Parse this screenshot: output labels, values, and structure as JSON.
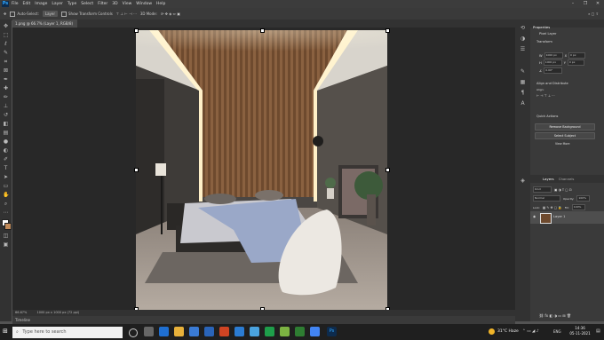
{
  "menu": {
    "logo": "Ps",
    "items": [
      "File",
      "Edit",
      "Image",
      "Layer",
      "Type",
      "Select",
      "Filter",
      "3D",
      "View",
      "Window",
      "Help"
    ],
    "window_controls": [
      "–",
      "❐",
      "✕"
    ]
  },
  "options": {
    "auto_select": "Auto-Select:",
    "layer_dropdown": "Layer",
    "show_transform": "Show Transform Controls",
    "mode_3d": "3D Mode:"
  },
  "document": {
    "tab_title": "1.png @ 66.7% (Layer 1, RGB/8)",
    "zoom": "66.67%",
    "doc_info": "1000 px x 1000 px (72 ppi)",
    "timeline": "Timeline"
  },
  "properties": {
    "title": "Properties",
    "subtitle": "Pixel Layer",
    "transform": "Transform",
    "w_label": "W",
    "h_label": "H",
    "x_label": "X",
    "y_label": "Y",
    "w": "1000 px",
    "h": "1000 px",
    "x": "0 px",
    "y": "0 px",
    "angle": "0.00°",
    "align": "Align and Distribute",
    "align_sub": "Align:",
    "quick": "Quick Actions",
    "remove_bg": "Remove Background",
    "select_subject": "Select Subject",
    "more": "View More"
  },
  "layers": {
    "tab1": "Layers",
    "tab2": "Channels",
    "kind": "Kind",
    "blend": "Normal",
    "opacity_label": "Opacity:",
    "opacity": "100%",
    "lock_label": "Lock:",
    "fill_label": "Fill:",
    "fill": "100%",
    "layer_name": "Layer 1"
  },
  "taskbar": {
    "search": "Type here to search",
    "weather": "31°C  Haze",
    "lang": "ENG",
    "time": "14:36",
    "date": "05-11-2021"
  },
  "colors": {
    "app_bg": "#535353",
    "panel": "#3a3a3a",
    "ps_blue": "#31a8ff"
  }
}
